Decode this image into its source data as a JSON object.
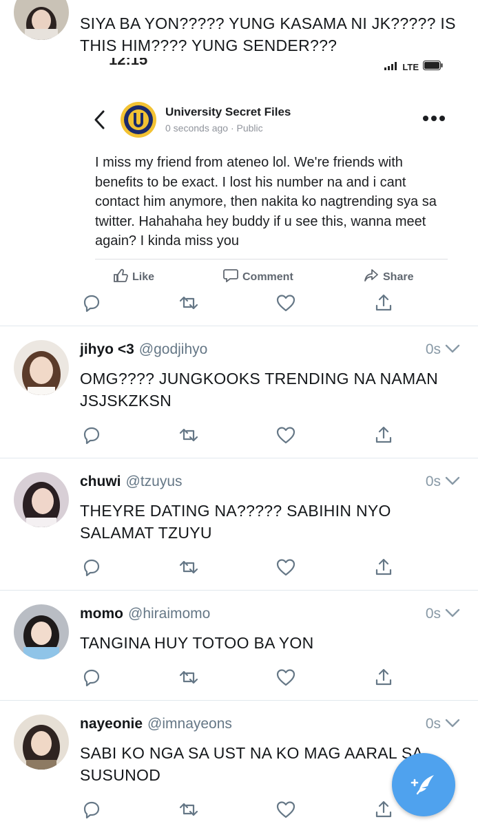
{
  "tweets": [
    {
      "text": "SIYA BA YON????? YUNG KASAMA NI JK?????  IS THIS HIM???? YUNG SENDER???",
      "embed": {
        "status_time": "12:15",
        "status_network": "LTE",
        "page_name": "University Secret Files",
        "post_meta": "0 seconds ago · Public",
        "post_text": "I miss my friend from ateneo lol. We're friends with benefits to be exact. I lost his number na and i cant contact him anymore, then nakita ko nagtrending sya sa twitter. Hahahaha hey buddy if u see this, wanna meet again? I kinda miss you",
        "like_label": "Like",
        "comment_label": "Comment",
        "share_label": "Share"
      }
    },
    {
      "name": "jihyo <3",
      "handle": "@godjihyo",
      "time": "0s",
      "text": "OMG???? JUNGKOOKS TRENDING NA NAMAN JSJSKZKSN"
    },
    {
      "name": "chuwi",
      "handle": "@tzuyus",
      "time": "0s",
      "text": "THEYRE DATING NA????? SABIHIN NYO SALAMAT TZUYU"
    },
    {
      "name": "momo",
      "handle": "@hiraimomo",
      "time": "0s",
      "text": "TANGINA HUY TOTOO BA YON"
    },
    {
      "name": "nayeonie",
      "handle": "@imnayeons",
      "time": "0s",
      "text": "SABI KO NGA SA UST NA KO MAG AARAL SA SUSUNOD"
    }
  ],
  "icons": {
    "reply": "reply-icon",
    "retweet": "retweet-icon",
    "like": "heart-icon",
    "share": "share-icon",
    "more": "chevron-down-icon",
    "compose": "compose-tweet-icon"
  },
  "colors": {
    "icon_gray": "#657786",
    "handle_gray": "#657786",
    "compose_blue": "#4fa2ee",
    "divider": "#e1e8ed"
  }
}
